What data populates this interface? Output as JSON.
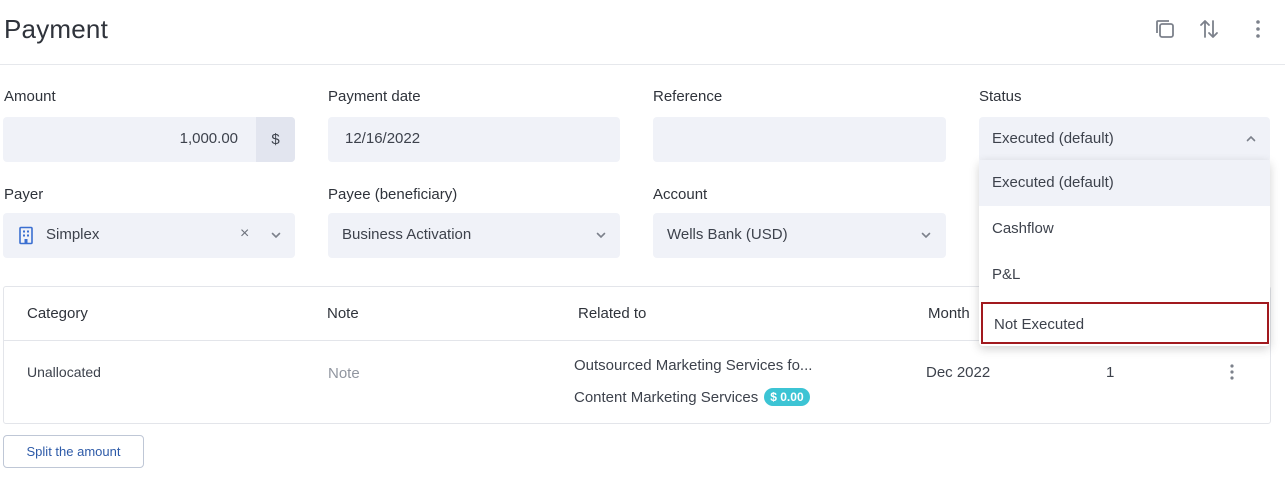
{
  "header": {
    "title": "Payment",
    "icons": [
      "copy-icon",
      "sort-arrows-icon",
      "more-vertical-icon"
    ]
  },
  "form": {
    "amount": {
      "label": "Amount",
      "value": "1,000.00",
      "currency": "$"
    },
    "payment_date": {
      "label": "Payment date",
      "value": "12/16/2022"
    },
    "reference": {
      "label": "Reference",
      "value": ""
    },
    "status": {
      "label": "Status",
      "value": "Executed (default)"
    },
    "payer": {
      "label": "Payer",
      "value": "Simplex",
      "clear": "×"
    },
    "payee": {
      "label": "Payee (beneficiary)",
      "value": "Business Activation"
    },
    "account": {
      "label": "Account",
      "value": "Wells Bank (USD)"
    }
  },
  "status_dropdown": {
    "options": [
      "Executed (default)",
      "Cashflow",
      "P&L",
      "Not Executed"
    ],
    "selected": "Executed (default)",
    "highlighted": "Not Executed"
  },
  "table": {
    "headers": {
      "category": "Category",
      "note": "Note",
      "related": "Related to",
      "month": "Month"
    },
    "row": {
      "category": "Unallocated",
      "note": "Note",
      "related_1": "Outsourced Marketing Services fo...",
      "related_2": "Content Marketing Services",
      "badge": "$ 0.00",
      "month": "Dec 2022",
      "qty": "1"
    }
  },
  "actions": {
    "split": "Split the amount"
  },
  "colors": {
    "field_bg": "#f0f2f8",
    "badge": "#3cc4d4",
    "highlight_border": "#a1191e",
    "link": "#2d5aa8"
  }
}
